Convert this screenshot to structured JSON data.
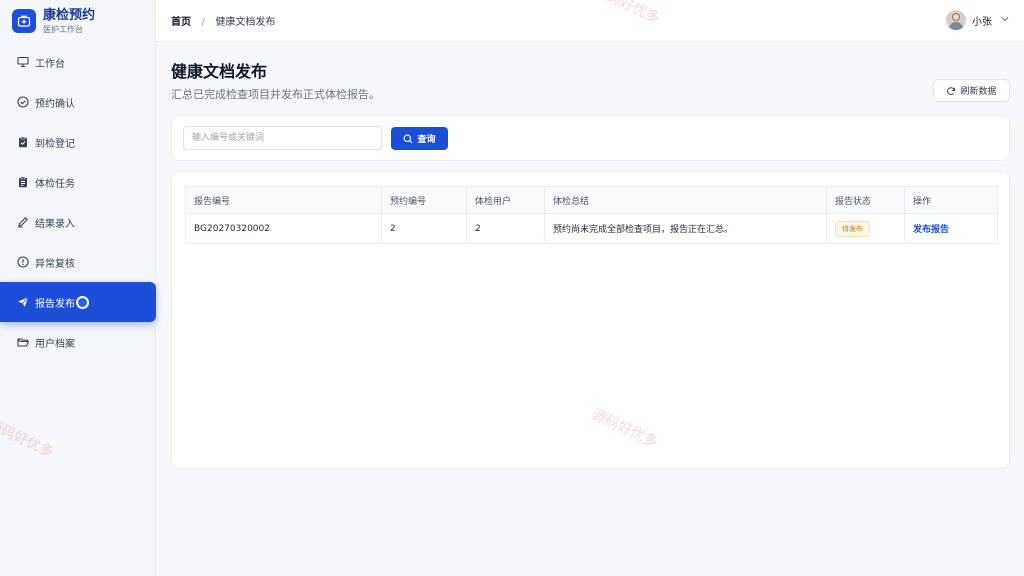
{
  "brand": {
    "title": "康检预约",
    "subtitle": "医护工作台"
  },
  "sidebar": {
    "items": [
      {
        "label": "工作台",
        "icon": "presentation-board-icon",
        "active": false
      },
      {
        "label": "预约确认",
        "icon": "check-circle-icon",
        "active": false
      },
      {
        "label": "到检登记",
        "icon": "clipboard-check-icon",
        "active": false
      },
      {
        "label": "体检任务",
        "icon": "clipboard-list-icon",
        "active": false
      },
      {
        "label": "结果录入",
        "icon": "pencil-icon",
        "active": false
      },
      {
        "label": "异常复核",
        "icon": "alert-circle-icon",
        "active": false
      },
      {
        "label": "报告发布",
        "icon": "paper-plane-icon",
        "active": true
      },
      {
        "label": "用户档案",
        "icon": "folder-open-icon",
        "active": false
      }
    ]
  },
  "breadcrumb": {
    "home": "首页",
    "separator": "/",
    "current": "健康文档发布"
  },
  "user": {
    "name": "小张"
  },
  "page": {
    "title": "健康文档发布",
    "subtitle": "汇总已完成检查项目并发布正式体检报告。"
  },
  "toolbar": {
    "refresh_label": "刷新数据"
  },
  "search": {
    "placeholder": "输入编号或关键词",
    "value": "",
    "button_label": "查询"
  },
  "table": {
    "headers": [
      "报告编号",
      "预约编号",
      "体检用户",
      "体检总结",
      "报告状态",
      "操作"
    ],
    "rows": [
      {
        "report_no": "BG20270320002",
        "appointment_no": "2",
        "user": "2",
        "summary": "预约尚未完成全部检查项目，报告正在汇总。",
        "status": "待发布",
        "action": "发布报告"
      }
    ]
  },
  "watermark": "源码好优多",
  "colors": {
    "primary": "#1d4ed8",
    "warning": "#d97706",
    "background": "#f7f8fb"
  }
}
